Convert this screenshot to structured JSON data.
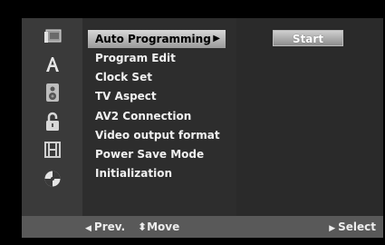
{
  "menu": {
    "items": [
      {
        "label": "Auto Programming",
        "selected": true
      },
      {
        "label": "Program Edit"
      },
      {
        "label": "Clock Set"
      },
      {
        "label": "TV Aspect"
      },
      {
        "label": "AV2 Connection"
      },
      {
        "label": "Video output format"
      },
      {
        "label": "Power Save Mode"
      },
      {
        "label": "Initialization"
      }
    ],
    "submenu_arrow": "▶"
  },
  "value_panel": {
    "start_label": "Start"
  },
  "icons": [
    "setup-icon",
    "language-icon",
    "audio-icon",
    "lock-icon",
    "film-icon",
    "disc-icon"
  ],
  "footer": {
    "prev_label": "Prev.",
    "move_label": "Move",
    "select_label": "Select",
    "prev_glyph": "◀",
    "move_glyph": "⬍",
    "select_glyph": "▶"
  },
  "colors": {
    "icon_column": "#3a3a3a",
    "menu_column": "#2d2d2d",
    "value_column": "#2a2a2a",
    "footer": "#595959",
    "highlight": "#c8c8c8"
  }
}
